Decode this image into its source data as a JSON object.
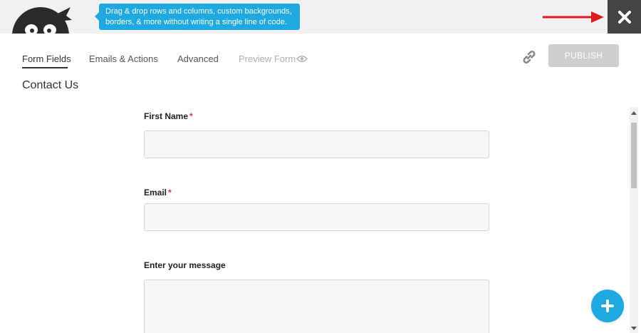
{
  "banner": {
    "tooltip_line1": "Drag & drop rows and columns, custom backgrounds,",
    "tooltip_line2": "borders, & more without writing a single line of code."
  },
  "tabs": [
    {
      "label": "Form Fields",
      "active": true
    },
    {
      "label": "Emails & Actions",
      "active": false
    },
    {
      "label": "Advanced",
      "active": false
    },
    {
      "label": "Preview Form",
      "active": false,
      "disabled": true
    }
  ],
  "toolbar": {
    "publish_label": "PUBLISH"
  },
  "form": {
    "title": "Contact Us",
    "fields": [
      {
        "label": "First Name",
        "required_mark": "*",
        "value": ""
      },
      {
        "label": "Email",
        "required_mark": "*",
        "value": ""
      },
      {
        "label": "Enter your message",
        "value": ""
      }
    ]
  },
  "colors": {
    "accent": "#1ea9e1",
    "close_bg": "#444444",
    "required": "#dd3333",
    "publish_disabled": "#cfcfcf"
  },
  "icons": [
    "ninja-logo-icon",
    "red-arrow-icon",
    "close-icon",
    "eye-icon",
    "link-icon",
    "plus-icon"
  ]
}
